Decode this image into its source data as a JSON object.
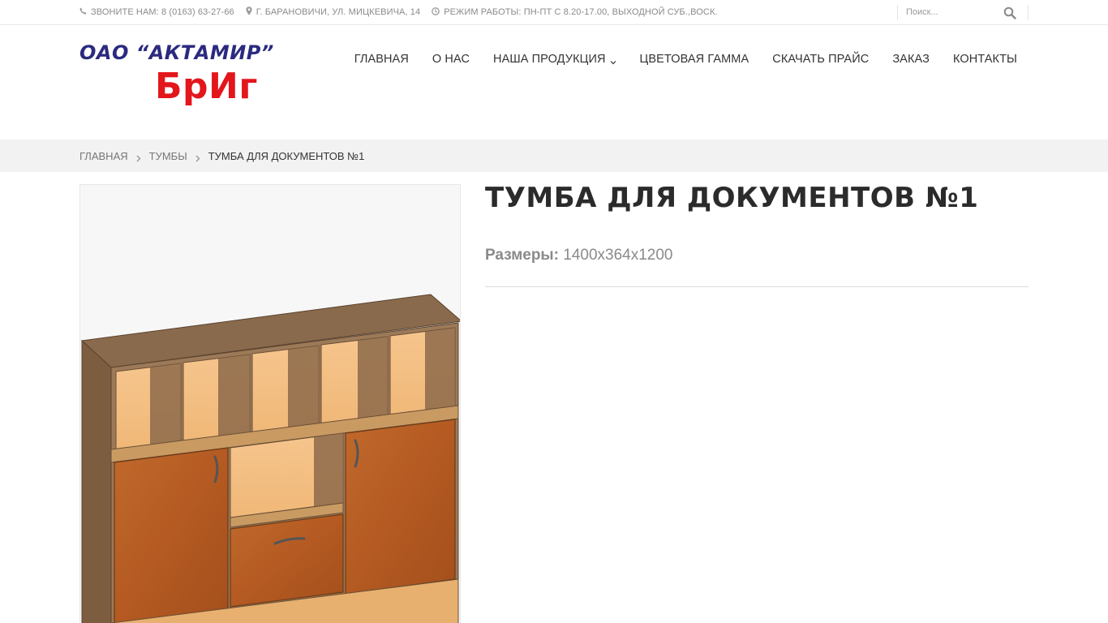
{
  "topbar": {
    "phone_label": "ЗВОНИТЕ НАМ: 8 (0163) 63-27-66",
    "address": "Г. БАРАНОВИЧИ, УЛ. МИЦКЕВИЧА, 14",
    "hours": "РЕЖИМ РАБОТЫ: ПН-ПТ С 8.20-17.00, ВЫХОДНОЙ СУБ.,ВОСК.",
    "search_placeholder": "Поиск..."
  },
  "logo": {
    "line1": "ОАО “АКТАМИР”",
    "line2": "БрИг"
  },
  "nav": {
    "items": [
      {
        "label": "ГЛАВНАЯ"
      },
      {
        "label": "О НАС"
      },
      {
        "label": "НАША ПРОДУКЦИЯ",
        "has_dropdown": true
      },
      {
        "label": "ЦВЕТОВАЯ ГАММА"
      },
      {
        "label": "СКАЧАТЬ ПРАЙС"
      },
      {
        "label": "ЗАКАЗ"
      },
      {
        "label": "КОНТАКТЫ"
      }
    ]
  },
  "breadcrumb": {
    "home": "ГЛАВНАЯ",
    "category": "ТУМБЫ",
    "current": "ТУМБА ДЛЯ ДОКУМЕНТОВ №1"
  },
  "product": {
    "title": "ТУМБА ДЛЯ ДОКУМЕНТОВ №1",
    "attr_label": "Размеры:",
    "attr_value": "1400x364x1200"
  },
  "colors": {
    "brand_blue": "#2b2a7f",
    "brand_red": "#e3161c",
    "text_dark": "#333333",
    "text_muted": "#8a8a8a",
    "breadcrumb_bg": "#f2f2f2"
  },
  "icons": {
    "phone": "phone-icon",
    "address": "map-marker-icon",
    "hours": "clock-icon",
    "search": "search-icon",
    "dropdown": "chevron-down-icon",
    "breadcrumb_separator": "chevron-right-icon"
  }
}
